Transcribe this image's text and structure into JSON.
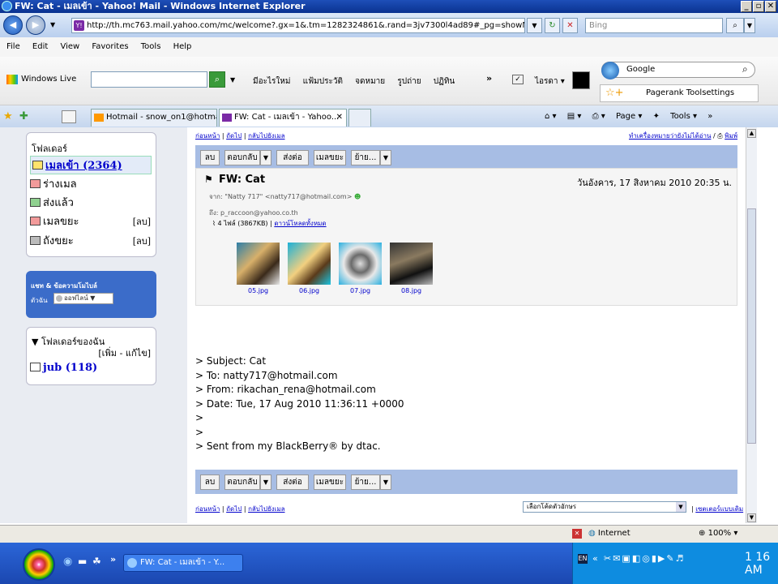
{
  "window": {
    "title": "FW: Cat - เมลเข้า - Yahoo! Mail - Windows Internet Explorer",
    "controls": [
      "_",
      "▫",
      "✕"
    ]
  },
  "address": {
    "url": "http://th.mc763.mail.yahoo.com/mc/welcome?.gx=1&.tm=1282324861&.rand=3jv7300l4ad89#_pg=showMessage&sMid=13&&filt",
    "search_placeholder": "Bing"
  },
  "menu": [
    "File",
    "Edit",
    "View",
    "Favorites",
    "Tools",
    "Help"
  ],
  "live": {
    "brand": "Windows Live",
    "nav": [
      "มีอะไรใหม่",
      "แฟ้มประวัติ",
      "จดหมาย",
      "รูปถ่าย",
      "ปฏิทิน"
    ],
    "more": "»",
    "extra": "ไอรดา ▾",
    "google": "Google",
    "pagerank": "Pagerank",
    "toolsettings": "Toolsettings"
  },
  "tabs": [
    {
      "label": "Hotmail - snow_on1@hotmail...."
    },
    {
      "label": "FW: Cat - เมลเข้า - Yahoo...",
      "close": "✕"
    }
  ],
  "toolbar_right": {
    "page": "Page ▾",
    "tools": "Tools ▾",
    "more": "»"
  },
  "sidebar": {
    "folders_title": "โฟลเดอร์",
    "folders": [
      {
        "label": "เมลเข้า (2364)"
      },
      {
        "label": "ร่างเมล"
      },
      {
        "label": "ส่งแล้ว"
      },
      {
        "label": "เมลขยะ",
        "tag": "[ลบ]"
      },
      {
        "label": "ถังขยะ",
        "tag": "[ลบ]"
      }
    ],
    "chat_title": "แชท & ข้อความโมไบล์",
    "chat_me": "ตัวฉัน",
    "chat_status": "ออฟไลน์ ▼",
    "my_folders_title": "▼ โฟลเดอร์ของฉัน",
    "my_folders_edit": "[เพิ่ม - แก้ไข]",
    "my_folders": [
      {
        "label": "jub (118)"
      }
    ]
  },
  "main": {
    "top_links": [
      "ก่อนหน้า",
      "ถัดไป",
      "กลับไปยังเมล"
    ],
    "top_right_links": [
      "ทำเครื่องหมายว่ายังไม่ได้อ่าน",
      "พิมพ์"
    ],
    "buttons": [
      "ลบ",
      "ตอบกลับ",
      "ส่งต่อ",
      "เมลขยะ",
      "ย้าย..."
    ],
    "subject": "FW: Cat",
    "date": "วันอังคาร, 17 สิงหาคม 2010 20:35 น.",
    "from_label": "จาก:",
    "from": "\"Natty 717\" <natty717@hotmail.com>",
    "to_label": "ถึง:",
    "to": "p_raccoon@yahoo.co.th",
    "attach_info": "4 ไฟล์ (3867KB)",
    "download_all": "ดาวน์โหลดทั้งหมด",
    "attachments": [
      "05.jpg",
      "06.jpg",
      "07.jpg",
      "08.jpg"
    ],
    "body_lines": [
      "> Subject: Cat",
      "> To: natty717@hotmail.com",
      "> From: rikachan_rena@hotmail.com",
      "> Date: Tue, 17 Aug 2010 11:36:11 +0000",
      ">",
      ">",
      "> Sent from my BlackBerry® by dtac."
    ],
    "encoding_select": "เลือกโค้ดตัวอักษร",
    "encoding_link": "เซตเตอร์แบบเดิม"
  },
  "status": {
    "zone": "Internet",
    "zoom": "100%"
  },
  "taskbar": {
    "window": "FW: Cat - เมลเข้า - Y...",
    "clock": "1 16 AM"
  }
}
